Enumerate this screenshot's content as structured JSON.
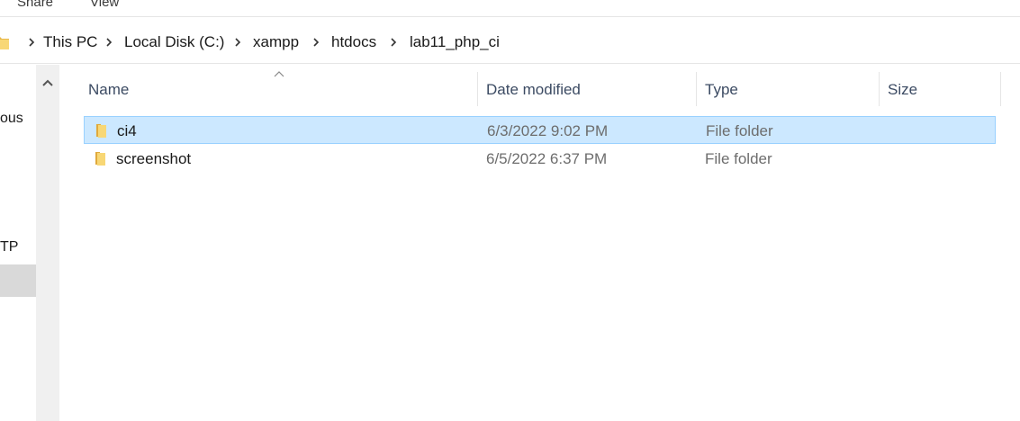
{
  "ribbon": {
    "tabs": [
      "Share",
      "View"
    ]
  },
  "address_bar": {
    "crumbs": [
      "This PC",
      "Local Disk (C:)",
      "xampp",
      "htdocs",
      "lab11_php_ci"
    ]
  },
  "nav_pane": {
    "items": [
      "ous",
      "TP"
    ]
  },
  "columns": [
    "Name",
    "Date modified",
    "Type",
    "Size"
  ],
  "files": [
    {
      "name": "ci4",
      "date": "6/3/2022 9:02 PM",
      "type": "File folder",
      "icon": "folder-icon",
      "selected": true
    },
    {
      "name": "screenshot",
      "date": "6/5/2022 6:37 PM",
      "type": "File folder",
      "icon": "folder-icon",
      "selected": false
    }
  ],
  "colors": {
    "selection": "#cce8ff",
    "selection_border": "#99d1ff",
    "folder": "#f8d775"
  }
}
